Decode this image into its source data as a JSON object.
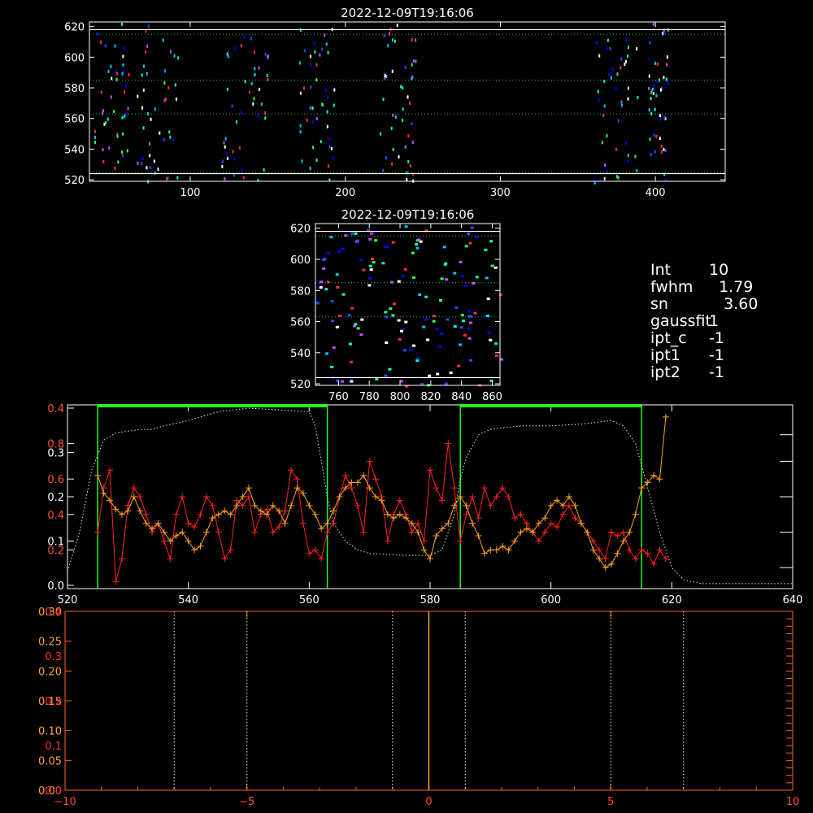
{
  "image1": {
    "title": "2022-12-09T19:16:06",
    "xlim": [
      35,
      445
    ],
    "ylim": [
      519,
      623
    ],
    "xticks": [
      100,
      200,
      300,
      400
    ],
    "yticks": [
      520,
      540,
      560,
      580,
      600,
      620
    ],
    "white_lines": [
      618,
      524
    ],
    "green_lines": [
      615,
      585,
      563,
      525
    ],
    "columns": [
      [
        38,
        60
      ],
      [
        62,
        92
      ],
      [
        120,
        150
      ],
      [
        170,
        193
      ],
      [
        222,
        245
      ],
      [
        360,
        390
      ],
      [
        395,
        408
      ]
    ],
    "colors": [
      "#0000ff",
      "#2050ff",
      "#00c8ff",
      "#00ffd0",
      "#30ff60",
      "#ff3030",
      "#c050ff",
      "#ffffff"
    ]
  },
  "image2": {
    "title": "2022-12-09T19:16:06",
    "xlim": [
      745,
      865
    ],
    "ylim": [
      519,
      623
    ],
    "xticks": [
      760,
      780,
      800,
      820,
      840,
      860
    ],
    "yticks": [
      520,
      540,
      560,
      580,
      600,
      620
    ],
    "white_lines": [
      618,
      524
    ],
    "green_lines": [
      615,
      585,
      563
    ]
  },
  "info": [
    {
      "key": "Int",
      "value": "10"
    },
    {
      "key": "fwhm",
      "value": "  1.79"
    },
    {
      "key": "sn",
      "value": "   3.60"
    },
    {
      "key": "gaussfit",
      "value": "1"
    },
    {
      "key": "ipt_c",
      "value": "-1"
    },
    {
      "key": "ipt1",
      "value": "-1"
    },
    {
      "key": "ipt2",
      "value": "-1"
    }
  ],
  "chart_data": [
    {
      "type": "line",
      "xlim": [
        520,
        640
      ],
      "xticks": [
        520,
        540,
        560,
        580,
        600,
        620,
        640
      ],
      "yticks_left": [
        {
          "label": "0.4",
          "value": 1.0
        },
        {
          "label": "0.8",
          "value": 0.8
        },
        {
          "label": "0.3",
          "value": 0.75
        },
        {
          "label": "0.6",
          "value": 0.6
        },
        {
          "label": "0.2",
          "value": 0.5
        },
        {
          "label": "0.4",
          "value": 0.4
        },
        {
          "label": "0.1",
          "value": 0.25
        },
        {
          "label": "0.2",
          "value": 0.2
        },
        {
          "label": "0.0",
          "value": 0.0
        }
      ],
      "ylim": [
        0,
        1.0
      ],
      "green_vlines": [
        525,
        563,
        585,
        615
      ],
      "green_bars": [
        [
          525,
          563
        ],
        [
          585,
          615
        ]
      ],
      "series": [
        {
          "color": "#ff2020",
          "x": [
            525,
            526,
            527,
            528,
            529,
            530,
            531,
            532,
            533,
            534,
            535,
            536,
            537,
            538,
            539,
            540,
            541,
            542,
            543,
            544,
            545,
            546,
            547,
            548,
            549,
            550,
            551,
            552,
            553,
            554,
            555,
            556,
            557,
            558,
            559,
            560,
            561,
            562,
            563,
            564,
            565,
            566,
            567,
            568,
            569,
            570,
            571,
            572,
            573,
            574,
            575,
            576,
            577,
            578,
            579,
            580,
            581,
            582,
            583,
            584,
            585,
            586,
            587,
            588,
            589,
            590,
            591,
            592,
            593,
            594,
            595,
            596,
            597,
            598,
            599,
            600,
            601,
            602,
            603,
            604,
            605,
            606,
            607,
            608,
            609,
            610,
            611,
            612,
            613,
            614,
            615,
            616,
            617,
            618,
            619
          ],
          "y": [
            0.3,
            0.55,
            0.65,
            0.02,
            0.15,
            0.45,
            0.55,
            0.5,
            0.4,
            0.3,
            0.35,
            0.25,
            0.15,
            0.4,
            0.5,
            0.35,
            0.33,
            0.4,
            0.5,
            0.45,
            0.3,
            0.15,
            0.2,
            0.48,
            0.45,
            0.5,
            0.3,
            0.4,
            0.43,
            0.3,
            0.33,
            0.42,
            0.65,
            0.6,
            0.35,
            0.18,
            0.2,
            0.15,
            0.3,
            0.35,
            0.5,
            0.62,
            0.55,
            0.45,
            0.3,
            0.7,
            0.6,
            0.5,
            0.25,
            0.4,
            0.48,
            0.4,
            0.3,
            0.35,
            0.25,
            0.65,
            0.55,
            0.48,
            0.8,
            0.55,
            0.25,
            0.4,
            0.5,
            0.38,
            0.55,
            0.45,
            0.5,
            0.55,
            0.5,
            0.38,
            0.4,
            0.35,
            0.3,
            0.25,
            0.3,
            0.35,
            0.33,
            0.4,
            0.45,
            0.38,
            0.35,
            0.3,
            0.25,
            0.2,
            0.15,
            0.3,
            0.28,
            0.3,
            0.2,
            0.15,
            0.2,
            0.18,
            0.12,
            0.2,
            0.15
          ]
        },
        {
          "color": "#ffa020",
          "x": [
            525,
            526,
            527,
            528,
            529,
            530,
            531,
            532,
            533,
            534,
            535,
            536,
            537,
            538,
            539,
            540,
            541,
            542,
            543,
            544,
            545,
            546,
            547,
            548,
            549,
            550,
            551,
            552,
            553,
            554,
            555,
            556,
            557,
            558,
            559,
            560,
            561,
            562,
            563,
            564,
            565,
            566,
            567,
            568,
            569,
            570,
            571,
            572,
            573,
            574,
            575,
            576,
            577,
            578,
            579,
            580,
            581,
            582,
            583,
            584,
            585,
            586,
            587,
            588,
            589,
            590,
            591,
            592,
            593,
            594,
            595,
            596,
            597,
            598,
            599,
            600,
            601,
            602,
            603,
            604,
            605,
            606,
            607,
            608,
            609,
            610,
            611,
            612,
            613,
            614,
            615,
            616,
            617,
            618,
            619
          ],
          "y": [
            0.62,
            0.52,
            0.48,
            0.43,
            0.4,
            0.42,
            0.5,
            0.42,
            0.35,
            0.32,
            0.35,
            0.3,
            0.25,
            0.28,
            0.3,
            0.25,
            0.2,
            0.22,
            0.3,
            0.38,
            0.4,
            0.42,
            0.4,
            0.45,
            0.5,
            0.55,
            0.45,
            0.42,
            0.4,
            0.45,
            0.42,
            0.35,
            0.45,
            0.55,
            0.52,
            0.45,
            0.4,
            0.32,
            0.35,
            0.42,
            0.5,
            0.55,
            0.58,
            0.58,
            0.62,
            0.55,
            0.5,
            0.48,
            0.4,
            0.38,
            0.4,
            0.38,
            0.35,
            0.3,
            0.2,
            0.15,
            0.28,
            0.32,
            0.35,
            0.45,
            0.5,
            0.45,
            0.35,
            0.28,
            0.18,
            0.2,
            0.2,
            0.22,
            0.2,
            0.25,
            0.3,
            0.32,
            0.3,
            0.35,
            0.38,
            0.45,
            0.48,
            0.45,
            0.5,
            0.45,
            0.35,
            0.3,
            0.2,
            0.15,
            0.1,
            0.12,
            0.18,
            0.25,
            0.3,
            0.4,
            0.55,
            0.58,
            0.62,
            0.6,
            0.95
          ]
        }
      ],
      "profile_dotted": {
        "color": "#c8ffc8",
        "x": [
          520,
          522,
          524,
          526,
          528,
          530,
          532,
          534,
          536,
          540,
          545,
          550,
          555,
          560,
          561,
          562,
          563,
          564,
          566,
          568,
          570,
          575,
          580,
          582,
          584,
          585,
          586,
          588,
          590,
          595,
          600,
          605,
          610,
          612,
          614,
          616,
          618,
          620,
          622,
          625,
          630,
          635,
          640
        ],
        "y": [
          0.08,
          0.3,
          0.65,
          0.82,
          0.86,
          0.87,
          0.88,
          0.88,
          0.9,
          0.93,
          0.98,
          1.0,
          0.99,
          0.98,
          0.9,
          0.7,
          0.5,
          0.35,
          0.25,
          0.2,
          0.18,
          0.17,
          0.17,
          0.2,
          0.4,
          0.6,
          0.72,
          0.85,
          0.88,
          0.9,
          0.9,
          0.91,
          0.93,
          0.9,
          0.8,
          0.55,
          0.3,
          0.1,
          0.03,
          0.01,
          0.01,
          0.01,
          0.01
        ]
      }
    },
    {
      "type": "line",
      "xlim": [
        -10,
        10
      ],
      "xticks": [
        -10,
        -5,
        0,
        5,
        10
      ],
      "yticks_left": [
        {
          "label": "0.30",
          "value": 0.3
        },
        {
          "label": "0.25",
          "value": 0.25
        },
        {
          "label": "0.20",
          "value": 0.2
        },
        {
          "label": "0.15",
          "value": 0.15
        },
        {
          "label": "0.10",
          "value": 0.1
        },
        {
          "label": "0.05",
          "value": 0.05
        },
        {
          "label": "0.00",
          "value": 0.0
        }
      ],
      "yticks_red": [
        {
          "label": "0.4",
          "value": 0.3
        },
        {
          "label": "0.3",
          "value": 0.225
        },
        {
          "label": "0.2",
          "value": 0.15
        },
        {
          "label": "0.1",
          "value": 0.075
        },
        {
          "label": "0.0",
          "value": 0.0
        }
      ],
      "ylim": [
        0,
        0.3
      ],
      "dotted_vlines": [
        -7,
        -5,
        -1,
        1,
        5,
        7
      ],
      "center_line": 0
    }
  ]
}
